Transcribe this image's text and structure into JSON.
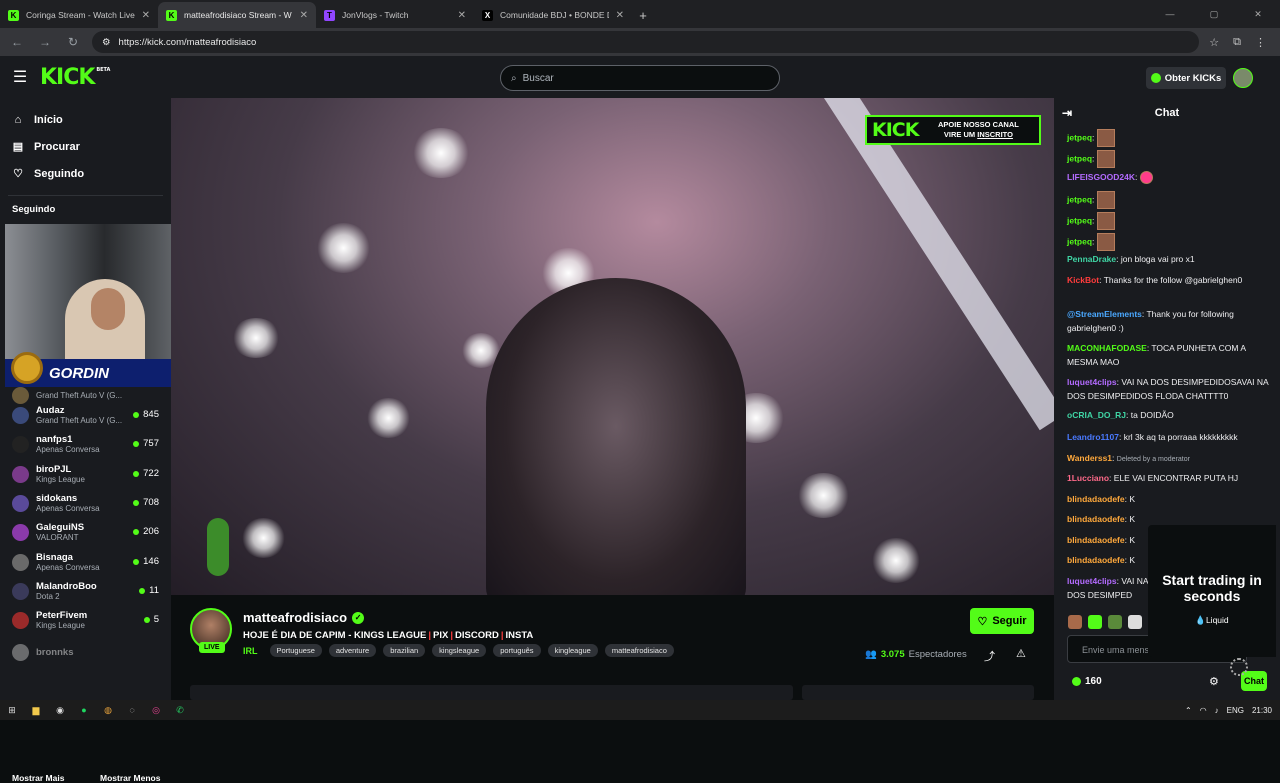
{
  "browser": {
    "tabs": [
      {
        "title": "Coringa Stream - Watch Live on",
        "fav_color": "#53fc18",
        "fav_glyph": "K",
        "active": false
      },
      {
        "title": "matteafrodisiaco Stream - W",
        "fav_color": "#53fc18",
        "fav_glyph": "K",
        "active": true
      },
      {
        "title": "JonVlogs - Twitch",
        "fav_color": "#9146ff",
        "fav_glyph": "T",
        "active": false
      },
      {
        "title": "Comunidade BDJ • BONDE DO",
        "fav_color": "#000000",
        "fav_glyph": "X",
        "active": false
      }
    ],
    "url": "https://kick.com/matteafrodisiaco"
  },
  "header": {
    "logo": "KICK",
    "logo_badge": "BETA",
    "search_placeholder": "Buscar",
    "get_kicks_label": "Obter KICKs"
  },
  "sidebar": {
    "nav": [
      {
        "icon": "home-icon",
        "glyph": "⌂",
        "label": "Início"
      },
      {
        "icon": "browse-icon",
        "glyph": "▤",
        "label": "Procurar"
      },
      {
        "icon": "heart-icon",
        "glyph": "♡",
        "label": "Seguindo"
      }
    ],
    "following_heading": "Seguindo",
    "popup_banner": "GORDIN",
    "channels": [
      {
        "name": "",
        "category": "Grand Theft Auto V (G...",
        "viewers": "",
        "color": "#6a5a3a"
      },
      {
        "name": "Audaz",
        "category": "Grand Theft Auto V (G...",
        "viewers": "845",
        "color": "#3a4a7a"
      },
      {
        "name": "nanfps1",
        "category": "Apenas Conversa",
        "viewers": "757",
        "color": "#222222"
      },
      {
        "name": "biroPJL",
        "category": "Kings League",
        "viewers": "722",
        "color": "#7a3a8a"
      },
      {
        "name": "sidokans",
        "category": "Apenas Conversa",
        "viewers": "708",
        "color": "#5a4a9a"
      },
      {
        "name": "GaleguiNS",
        "category": "VALORANT",
        "viewers": "206",
        "color": "#8a3aaa"
      },
      {
        "name": "Bisnaga",
        "category": "Apenas Conversa",
        "viewers": "146",
        "color": "#6a6a6a"
      },
      {
        "name": "MalandroBoo",
        "category": "Dota 2",
        "viewers": "11",
        "color": "#3a3a5a"
      },
      {
        "name": "PeterFivem",
        "category": "Kings League",
        "viewers": "5",
        "color": "#9a2a2a"
      },
      {
        "name": "bronnks",
        "category": "",
        "viewers": "",
        "color": "#cccccc"
      }
    ],
    "show_more": "Mostrar Mais",
    "show_less": "Mostrar Menos"
  },
  "overlay_ad": {
    "logo": "KICK",
    "line1": "APOIE NOSSO CANAL",
    "line2_pre": "VIRE UM ",
    "line2_link": "INSCRITO"
  },
  "stream": {
    "channel": "matteafrodisiaco",
    "live_label": "LIVE",
    "title_parts": [
      "HOJE É DIA DE CAPIM - KINGS LEAGUE",
      "PIX",
      "DISCORD",
      "INSTA"
    ],
    "category": "IRL",
    "tags": [
      "Portuguese",
      "adventure",
      "brazilian",
      "kingsleague",
      "português",
      "kingleague",
      "matteafrodisiaco"
    ],
    "follow_label": "Seguir",
    "viewers": "3.075",
    "viewers_label": "Espectadores"
  },
  "chat": {
    "title": "Chat",
    "messages": [
      {
        "user": "jetpeq",
        "color": "#53fc18",
        "text": "",
        "emote": true
      },
      {
        "user": "jetpeq",
        "color": "#53fc18",
        "text": "",
        "emote": true
      },
      {
        "user": "LIFEISGOOD24K",
        "color": "#b36bff",
        "text": "",
        "emote": false,
        "heart": true
      },
      {
        "user": "jetpeq",
        "color": "#53fc18",
        "text": "",
        "emote": true
      },
      {
        "user": "jetpeq",
        "color": "#53fc18",
        "text": "",
        "emote": true
      },
      {
        "user": "jetpeq",
        "color": "#53fc18",
        "text": "",
        "emote": true
      },
      {
        "user": "PennaDrake",
        "color": "#3fd5a4",
        "text": "jon bloga vai pro x1",
        "emote": false
      },
      {
        "user": "KickBot",
        "color": "#ff3c3c",
        "text": "Thanks for the follow @gabrielghen0",
        "emote": false
      },
      {
        "user": "@StreamElements",
        "color": "#4aa8ff",
        "text": "Thank you for following gabrielghen0 :)",
        "emote": false
      },
      {
        "user": "MACONHAFODASE",
        "color": "#53fc18",
        "text": "TOCA PUNHETA COM A MESMA MAO",
        "emote": false
      },
      {
        "user": "luquet4clips",
        "color": "#b36bff",
        "text": "VAI NA DOS DESIMPEDIDOSAVAI NA DOS DESIMPEDIDOS FLODA CHATTTT0",
        "emote": false
      },
      {
        "user": "oCRIA_DO_RJ",
        "color": "#3fd5a4",
        "text": "ta DOIDÃO",
        "emote": false
      },
      {
        "user": "Leandro1107",
        "color": "#4a7aff",
        "text": "krl 3k aq ta porraaa kkkkkkkkk",
        "emote": false
      },
      {
        "user": "Wanderss1",
        "color": "#ffa93c",
        "text": "Deleted by a moderator",
        "emote": false,
        "deleted": true
      },
      {
        "user": "1Lucciano",
        "color": "#ff6a8a",
        "text": "ELE VAI ENCONTRAR PUTA HJ",
        "emote": false
      },
      {
        "user": "blindadaodefe",
        "color": "#ffa93c",
        "text": "K",
        "emote": false
      },
      {
        "user": "blindadaodefe",
        "color": "#ffa93c",
        "text": "K",
        "emote": false
      },
      {
        "user": "blindadaodefe",
        "color": "#ffa93c",
        "text": "K",
        "emote": false
      },
      {
        "user": "blindadaodefe",
        "color": "#ffa93c",
        "text": "K",
        "emote": false
      },
      {
        "user": "luquet4clips",
        "color": "#b36bff",
        "text": "VAI NA DOS DESIMPEDIDOSAVAI NA DOS DESIMPED",
        "emote": false
      }
    ],
    "input_placeholder": "Envie uma mensagem",
    "points": "160",
    "send_label": "Chat"
  },
  "ad": {
    "headline": "Start trading in seconds",
    "brand": "Liquid"
  },
  "taskbar": {
    "lang": "ENG",
    "time": "21:30"
  },
  "colors": {
    "accent": "#53fc18",
    "bg": "#0b0e0f",
    "panel": "#191b1f"
  }
}
